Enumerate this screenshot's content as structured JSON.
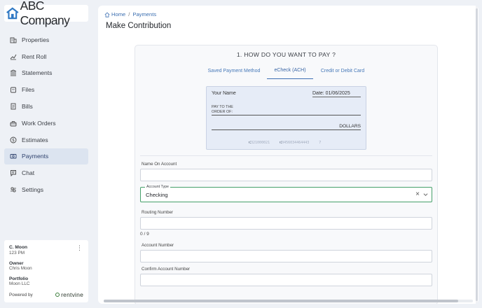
{
  "brand": {
    "name": "ABC Company",
    "accent": "#3e6fb3"
  },
  "nav": {
    "items": [
      {
        "label": "Properties",
        "icon": "building-icon"
      },
      {
        "label": "Rent Roll",
        "icon": "trend-icon"
      },
      {
        "label": "Statements",
        "icon": "bank-icon"
      },
      {
        "label": "Files",
        "icon": "folder-icon"
      },
      {
        "label": "Bills",
        "icon": "bill-icon"
      },
      {
        "label": "Work Orders",
        "icon": "toolbox-icon"
      },
      {
        "label": "Estimates",
        "icon": "dollar-icon"
      },
      {
        "label": "Payments",
        "icon": "payment-icon",
        "active": true
      },
      {
        "label": "Chat",
        "icon": "chat-icon"
      },
      {
        "label": "Settings",
        "icon": "settings-icon"
      }
    ]
  },
  "user": {
    "name": "C. Moon",
    "unit": "123 PM",
    "role_label": "Owner",
    "role_value": "Chris Moon",
    "portfolio_label": "Portfolio",
    "portfolio_value": "Moon LLC",
    "powered_by": "Powered by",
    "vendor": "rentvine"
  },
  "breadcrumb": {
    "home": "Home",
    "separator": "/",
    "current": "Payments"
  },
  "page": {
    "title": "Make Contribution"
  },
  "payment": {
    "question": "1. HOW DO YOU WANT TO PAY ?",
    "tabs": [
      {
        "label": "Saved Payment Method",
        "active": false
      },
      {
        "label": "eCheck (ACH)",
        "active": true
      },
      {
        "label": "Credit or Debit Card",
        "active": false
      }
    ],
    "check": {
      "your_name": "Your Name",
      "date": "Date: 01/06/2025",
      "pay_to_line1": "PAY TO THE",
      "pay_to_line2": "ORDER OF:",
      "dollars": "DOLLARS",
      "routing_sym": "⑆",
      "routing": "321000021",
      "account_sym": "⑆",
      "account": "0456034464443",
      "check_no": "7"
    },
    "fields": {
      "name_on_account": {
        "label": "Name On Account",
        "value": ""
      },
      "account_type": {
        "label": "Account Type",
        "value": "Checking"
      },
      "routing_number": {
        "label": "Routing Number",
        "value": "",
        "counter": "0 / 9"
      },
      "account_number": {
        "label": "Account Number",
        "value": ""
      },
      "confirm_account_number": {
        "label": "Confirm Account Number",
        "value": ""
      }
    }
  }
}
